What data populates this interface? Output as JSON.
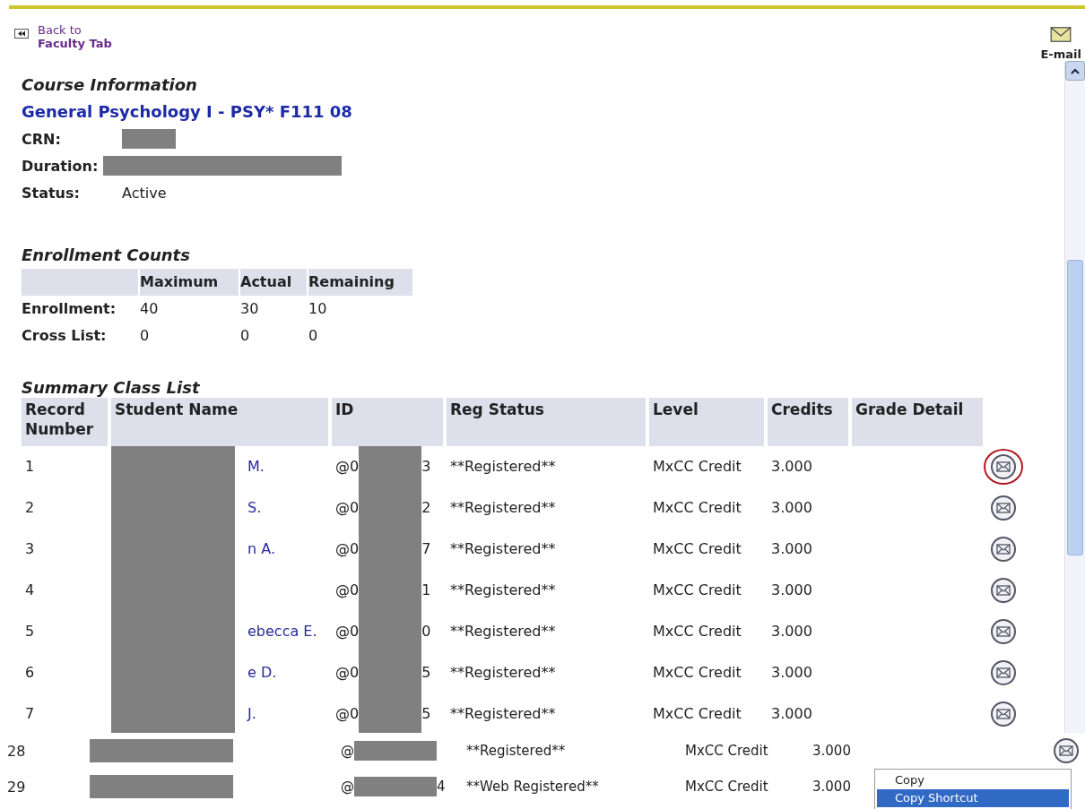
{
  "nav": {
    "line1": "Back to",
    "line2": "Faculty Tab"
  },
  "email_action": {
    "label": "E-mail"
  },
  "course_info": {
    "heading": "Course Information",
    "title": "General Psychology I - PSY* F111 08",
    "fields": [
      {
        "label": "CRN:",
        "kind": "redacted-short"
      },
      {
        "label": "Duration:",
        "kind": "redacted-long"
      },
      {
        "label": "Status:",
        "value": "Active",
        "kind": "text"
      }
    ]
  },
  "enrollment_counts": {
    "heading": "Enrollment Counts",
    "columns": [
      "Maximum",
      "Actual",
      "Remaining"
    ],
    "rows": [
      {
        "label": "Enrollment:",
        "values": [
          "40",
          "30",
          "10"
        ]
      },
      {
        "label": "Cross List:",
        "values": [
          "0",
          "0",
          "0"
        ]
      }
    ]
  },
  "class_list": {
    "heading": "Summary Class List",
    "columns": [
      "Record Number",
      "Student Name",
      "ID",
      "Reg Status",
      "Level",
      "Credits",
      "Grade Detail"
    ],
    "rows": [
      {
        "number": "1",
        "name": "M.",
        "id_start": "@0",
        "id_end": "3",
        "reg_status": "**Registered**",
        "level": "MxCC Credit",
        "credits": "3.000",
        "circled": true
      },
      {
        "number": "2",
        "name": "S.",
        "id_start": "@0",
        "id_end": "2",
        "reg_status": "**Registered**",
        "level": "MxCC Credit",
        "credits": "3.000",
        "circled": false
      },
      {
        "number": "3",
        "name": "n A.",
        "id_start": "@0",
        "id_end": "7",
        "reg_status": "**Registered**",
        "level": "MxCC Credit",
        "credits": "3.000",
        "circled": false
      },
      {
        "number": "4",
        "id_start": "@0",
        "id_end": "1",
        "reg_status": "**Registered**",
        "level": "MxCC Credit",
        "credits": "3.000",
        "circled": false
      },
      {
        "number": "5",
        "name": "ebecca E.",
        "id_start": "@0",
        "id_end": "0",
        "reg_status": "**Registered**",
        "level": "MxCC Credit",
        "credits": "3.000",
        "circled": false
      },
      {
        "number": "6",
        "name": "e D.",
        "id_start": "@0",
        "id_end": "5",
        "reg_status": "**Registered**",
        "level": "MxCC Credit",
        "credits": "3.000",
        "circled": false
      },
      {
        "number": "7",
        "name": "J.",
        "id_start": "@0",
        "id_end": "5",
        "reg_status": "**Registered**",
        "level": "MxCC Credit",
        "credits": "3.000",
        "circled": false
      }
    ]
  },
  "more_rows": [
    {
      "number": "28",
      "id_start": "@",
      "reg_status": "**Registered**",
      "level": "MxCC Credit",
      "credits": "3.000"
    },
    {
      "number": "29",
      "id_start": "@",
      "id_end": "4",
      "reg_status": "**Web Registered**",
      "level": "MxCC Credit",
      "credits": "3.000"
    }
  ],
  "context_menu": {
    "items": [
      {
        "label": "Copy",
        "selected": false
      },
      {
        "label": "Copy Shortcut",
        "selected": true
      }
    ]
  }
}
